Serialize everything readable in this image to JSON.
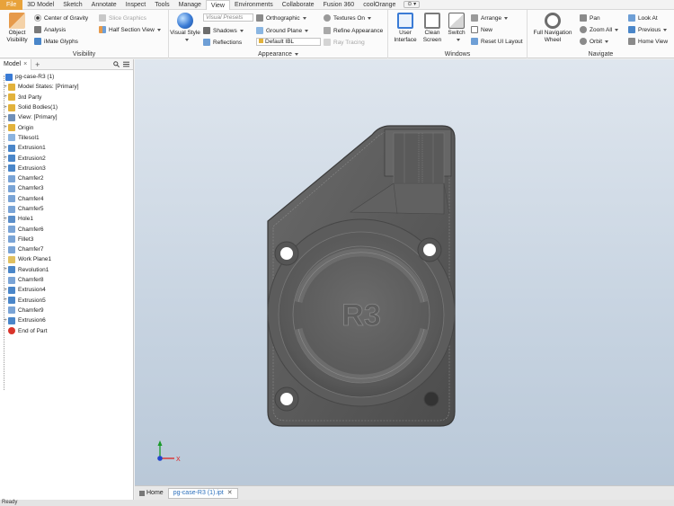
{
  "menu": {
    "items": [
      "File",
      "3D Model",
      "Sketch",
      "Annotate",
      "Inspect",
      "Tools",
      "Manage",
      "View",
      "Environments",
      "Collaborate",
      "Fusion 360",
      "coolOrange"
    ],
    "active": "View",
    "extra_icon": "toggle-icon"
  },
  "ribbon": {
    "visibility": {
      "title": "Visibility",
      "object_visibility": "Object Visibility",
      "center_of_gravity": "Center of Gravity",
      "analysis": "Analysis",
      "imate_glyphs": "iMate Glyphs",
      "slice_graphics": "Slice Graphics",
      "half_section_view": "Half Section View"
    },
    "appearance": {
      "title": "Appearance",
      "visual_style": "Visual Style",
      "visual_presets": "Visual Presets",
      "orthographic": "Orthographic",
      "textures_on": "Textures On",
      "shadows": "Shadows",
      "ground_plane": "Ground Plane",
      "refine_appearance": "Refine Appearance",
      "reflections": "Reflections",
      "lighting": "Default IBL",
      "ray_tracing": "Ray Tracing"
    },
    "windows": {
      "title": "Windows",
      "user_interface": "User Interface",
      "clean_screen": "Clean Screen",
      "switch": "Switch",
      "arrange": "Arrange",
      "new": "New",
      "reset_ui_layout": "Reset UI Layout"
    },
    "navigate": {
      "title": "Navigate",
      "full_navigation_wheel": "Full Navigation Wheel",
      "pan": "Pan",
      "zoom_all": "Zoom All",
      "orbit": "Orbit",
      "look_at": "Look At",
      "previous": "Previous",
      "home_view": "Home View"
    }
  },
  "browser": {
    "tab": "Model",
    "plus": "+",
    "items": [
      {
        "label": "pg-case-R3 (1)",
        "icon": "part-icon",
        "color": "#3a7bd5",
        "indent": 0,
        "expand": ""
      },
      {
        "label": "Model States: [Primary]",
        "icon": "folder-icon",
        "color": "#e2b23c",
        "indent": 1,
        "expand": "+"
      },
      {
        "label": "3rd Party",
        "icon": "folder-icon",
        "color": "#e2b23c",
        "indent": 1,
        "expand": "+"
      },
      {
        "label": "Solid Bodies(1)",
        "icon": "folder-icon",
        "color": "#e2b23c",
        "indent": 1,
        "expand": "+"
      },
      {
        "label": "View: [Primary]",
        "icon": "view-icon",
        "color": "#6f8fb8",
        "indent": 1,
        "expand": "+"
      },
      {
        "label": "Origin",
        "icon": "folder-icon",
        "color": "#e2b23c",
        "indent": 1,
        "expand": "+"
      },
      {
        "label": "Tillesol1",
        "icon": "sketch-icon",
        "color": "#8bb3df",
        "indent": 1,
        "expand": ""
      },
      {
        "label": "Extrusion1",
        "icon": "extrude-icon",
        "color": "#4a86c9",
        "indent": 1,
        "expand": "+"
      },
      {
        "label": "Extrusion2",
        "icon": "extrude-icon",
        "color": "#4a86c9",
        "indent": 1,
        "expand": "+"
      },
      {
        "label": "Extrusion3",
        "icon": "extrude-icon",
        "color": "#4a86c9",
        "indent": 1,
        "expand": "+"
      },
      {
        "label": "Chamfer2",
        "icon": "chamfer-icon",
        "color": "#7aa4d6",
        "indent": 1,
        "expand": ""
      },
      {
        "label": "Chamfer3",
        "icon": "chamfer-icon",
        "color": "#7aa4d6",
        "indent": 1,
        "expand": ""
      },
      {
        "label": "Chamfer4",
        "icon": "chamfer-icon",
        "color": "#7aa4d6",
        "indent": 1,
        "expand": ""
      },
      {
        "label": "Chamfer5",
        "icon": "chamfer-icon",
        "color": "#7aa4d6",
        "indent": 1,
        "expand": ""
      },
      {
        "label": "Hole1",
        "icon": "hole-icon",
        "color": "#5b8ec9",
        "indent": 1,
        "expand": "+"
      },
      {
        "label": "Chamfer6",
        "icon": "chamfer-icon",
        "color": "#7aa4d6",
        "indent": 1,
        "expand": ""
      },
      {
        "label": "Fillet3",
        "icon": "fillet-icon",
        "color": "#7aa4d6",
        "indent": 1,
        "expand": ""
      },
      {
        "label": "Chamfer7",
        "icon": "chamfer-icon",
        "color": "#7aa4d6",
        "indent": 1,
        "expand": ""
      },
      {
        "label": "Work Plane1",
        "icon": "work-plane-icon",
        "color": "#e0c060",
        "indent": 1,
        "expand": ""
      },
      {
        "label": "Revolution1",
        "icon": "revolve-icon",
        "color": "#4a86c9",
        "indent": 1,
        "expand": "+"
      },
      {
        "label": "Chamfer8",
        "icon": "chamfer-icon",
        "color": "#7aa4d6",
        "indent": 1,
        "expand": ""
      },
      {
        "label": "Extrusion4",
        "icon": "extrude-icon",
        "color": "#4a86c9",
        "indent": 1,
        "expand": "+"
      },
      {
        "label": "Extrusion5",
        "icon": "extrude-icon",
        "color": "#4a86c9",
        "indent": 1,
        "expand": "+"
      },
      {
        "label": "Chamfer9",
        "icon": "chamfer-icon",
        "color": "#7aa4d6",
        "indent": 1,
        "expand": ""
      },
      {
        "label": "Extrusion6",
        "icon": "extrude-icon",
        "color": "#4a86c9",
        "indent": 1,
        "expand": "+"
      },
      {
        "label": "End of Part",
        "icon": "end-of-part-icon",
        "color": "#d9342b",
        "indent": 1,
        "expand": ""
      }
    ]
  },
  "viewport": {
    "part_text": "R3",
    "axis_x": "X"
  },
  "doc_tabs": {
    "home": "Home",
    "active": "pg-case-R3 (1).ipt",
    "close": "✕"
  },
  "status": "Ready"
}
